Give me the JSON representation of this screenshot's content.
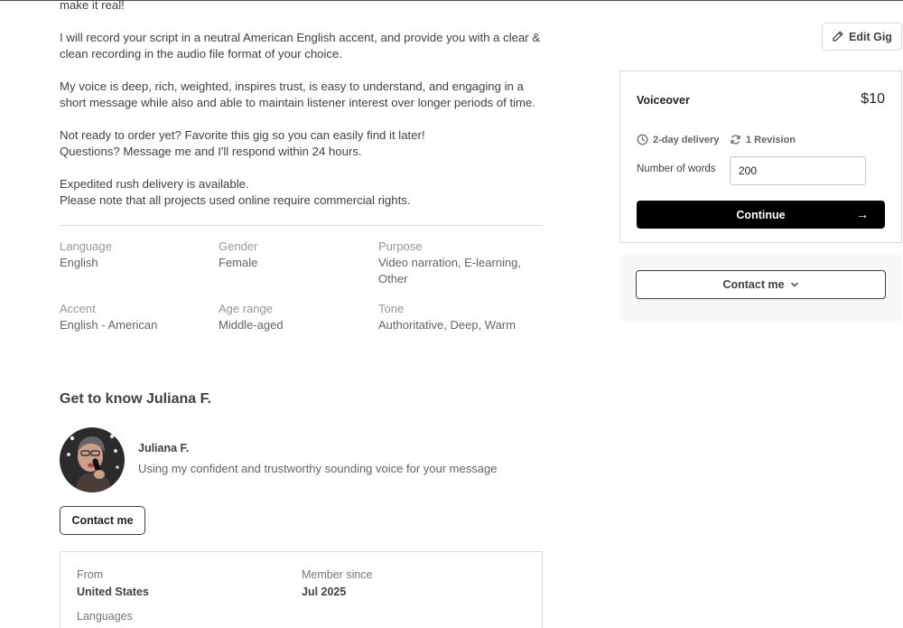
{
  "description": {
    "paragraphs": [
      [
        "make it real!"
      ],
      [
        "I will record your script in a neutral American English accent, and provide you with a clear &",
        "clean recording in the audio file format of your choice."
      ],
      [
        "My voice is deep, rich, weighted, inspires trust, is easy to understand, and engaging in a",
        "short message while also and able to maintain listener interest over longer periods of time."
      ],
      [
        "Not ready to order yet? Favorite this gig so you can easily find it later!",
        "Questions? Message me and I'll respond within 24 hours."
      ],
      [
        "Expedited rush delivery is available.",
        "Please note that all projects used online require commercial rights."
      ]
    ]
  },
  "attributes": {
    "language": {
      "label": "Language",
      "value": "English"
    },
    "gender": {
      "label": "Gender",
      "value": "Female"
    },
    "purpose": {
      "label": "Purpose",
      "value_line1": "Video narration, E-learning,",
      "value_line2": "Other"
    },
    "accent": {
      "label": "Accent",
      "value": "English - American"
    },
    "age_range": {
      "label": "Age range",
      "value": "Middle-aged"
    },
    "tone": {
      "label": "Tone",
      "value": "Authoritative, Deep, Warm"
    }
  },
  "about": {
    "title": "Get to know Juliana F.",
    "seller_name": "Juliana F.",
    "tagline": "Using my confident and trustworthy sounding voice for your message",
    "contact_label": "Contact me",
    "from_label": "From",
    "from_value": "United States",
    "member_label": "Member since",
    "member_value": "Jul 2025",
    "languages_label": "Languages"
  },
  "sidebar": {
    "edit_gig_label": "Edit Gig",
    "package_name": "Voiceover",
    "price": "$10",
    "delivery": "2-day delivery",
    "revisions": "1 Revision",
    "words_label": "Number of words",
    "words_value": "200",
    "continue_label": "Continue",
    "contact_label": "Contact me"
  },
  "icons": {
    "edit": "pencil-icon",
    "delivery": "clock-icon",
    "revision": "refresh-icon",
    "continue": "arrow-right-icon",
    "contact": "chevron-down-icon"
  },
  "colors": {
    "primary_button": "#000000",
    "text_dark": "#404145",
    "text_muted": "#95979d",
    "border": "#dadbdd",
    "panel_bg": "#f7f7f7"
  }
}
